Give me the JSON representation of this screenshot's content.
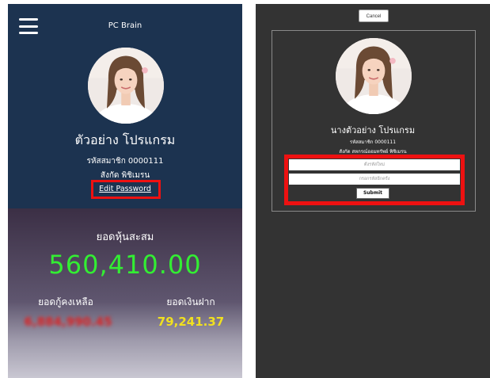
{
  "left_screen": {
    "app_title": "PC Brain",
    "member_name": "ตัวอย่าง โปรแกรม",
    "member_id": "รหัสสมาชิก 0000111",
    "member_unit": "สังกัด พิชิเมรน",
    "edit_password_label": "Edit Password",
    "shares_label": "ยอดหุ้นสะสม",
    "shares_value": "560,410.00",
    "loan_label": "ยอดกู้คงเหลือ",
    "loan_value": "6,884,990.45",
    "deposit_label": "ยอดเงินฝาก",
    "deposit_value": "79,241.37"
  },
  "right_screen": {
    "cancel_label": "Cancel",
    "member_name": "นางตัวอย่าง โปรแกรม",
    "member_id": "รหัสสมาชิก 0000111",
    "member_org": "สังกัด สหกรณ์ออมทรัพย์ พิชิเมรน",
    "new_password_placeholder": "ตั้งรหัสใหม่",
    "confirm_password_placeholder": "กรอกรหัสอีกครั้ง",
    "submit_label": "Submit"
  },
  "colors": {
    "header_bg": "#1c3350",
    "shares_green": "#33ee33",
    "loan_red": "#dd2222",
    "deposit_yellow": "#f0e020",
    "highlight_red": "#ee1111",
    "dialog_bg": "#333333"
  },
  "icons": [
    "menu-icon"
  ]
}
